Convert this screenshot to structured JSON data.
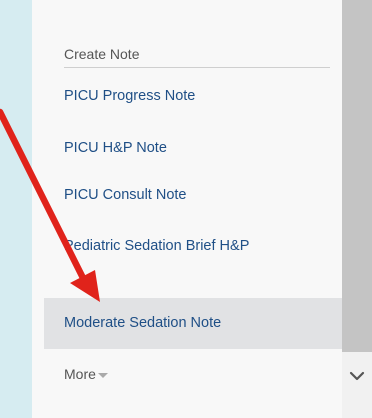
{
  "menu": {
    "header": "Create Note",
    "items": [
      {
        "label": "PICU Progress Note"
      },
      {
        "label": "PICU H&P Note"
      },
      {
        "label": "PICU Consult Note"
      },
      {
        "label": "Pediatric Sedation Brief H&P"
      },
      {
        "label": "Moderate Sedation Note"
      }
    ],
    "more_label": "More"
  },
  "colors": {
    "background": "#d6ecf1",
    "link": "#1f4f86",
    "highlight": "#e1e2e4",
    "annotation_arrow": "#e0231b"
  },
  "icons": {
    "more_caret": "caret-down-icon",
    "scroll_down": "chevron-down-icon",
    "annotation": "red-arrow-icon"
  }
}
